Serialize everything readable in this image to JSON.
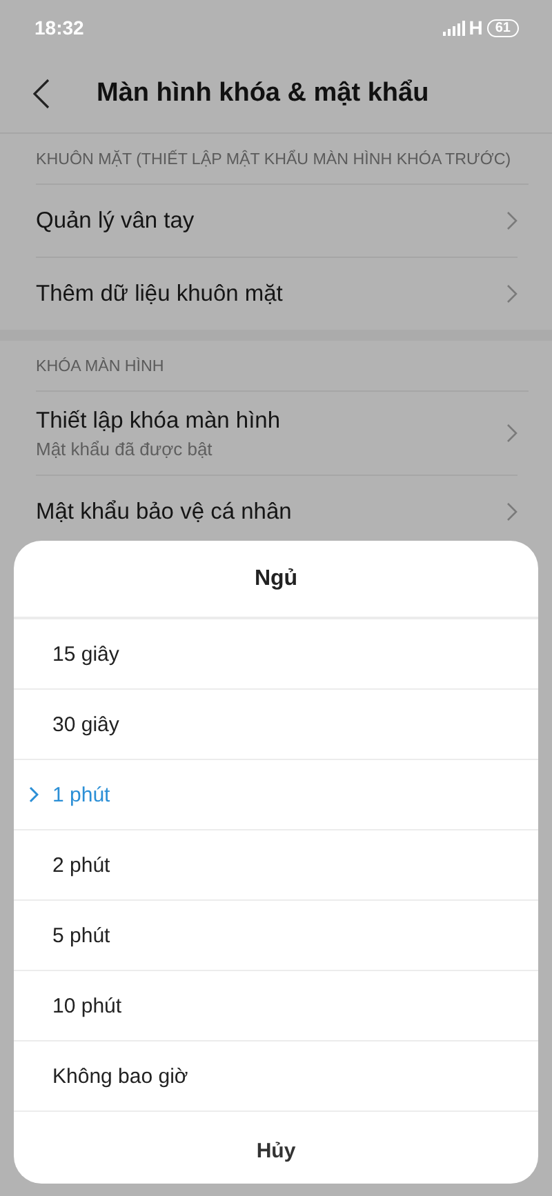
{
  "status_bar": {
    "time": "18:32",
    "network": "H",
    "battery": "61"
  },
  "header": {
    "title": "Màn hình khóa & mật khẩu"
  },
  "sections": [
    {
      "title": "KHUÔN MẶT (THIẾT LẬP MẬT KHẨU MÀN HÌNH KHÓA TRƯỚC)",
      "items": [
        {
          "label": "Quản lý vân tay"
        },
        {
          "label": "Thêm dữ liệu khuôn mặt"
        }
      ]
    },
    {
      "title": "KHÓA MÀN HÌNH",
      "items": [
        {
          "label": "Thiết lập khóa màn hình",
          "subtitle": "Mật khẩu đã được bật"
        },
        {
          "label": "Mật khẩu bảo vệ cá nhân"
        }
      ]
    }
  ],
  "sheet": {
    "title": "Ngủ",
    "options": [
      {
        "label": "15 giây",
        "selected": false
      },
      {
        "label": "30 giây",
        "selected": false
      },
      {
        "label": "1 phút",
        "selected": true
      },
      {
        "label": "2 phút",
        "selected": false
      },
      {
        "label": "5 phút",
        "selected": false
      },
      {
        "label": "10 phút",
        "selected": false
      },
      {
        "label": "Không bao giờ",
        "selected": false
      }
    ],
    "cancel": "Hủy"
  }
}
